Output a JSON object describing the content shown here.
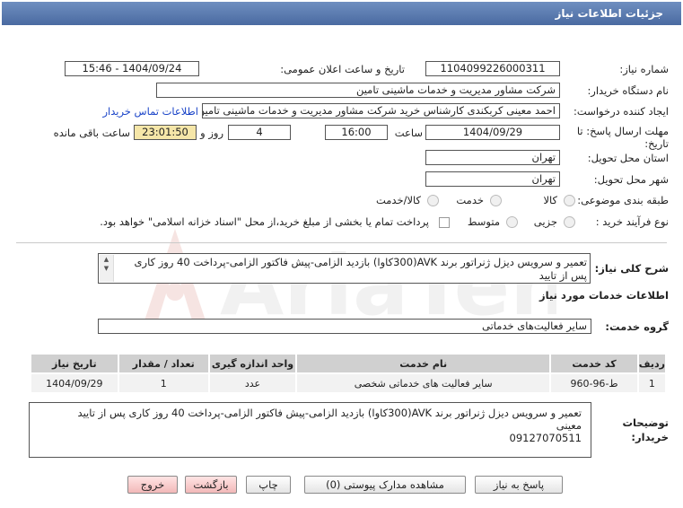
{
  "header": {
    "title": "جزئیات اطلاعات نیاز"
  },
  "form": {
    "need_number_label": "شماره نیاز:",
    "need_number": "1104099226000311",
    "announce_label": "تاریخ و ساعت اعلان عمومی:",
    "announce_value": "1404/09/24 - 15:46",
    "buyer_org_label": "نام دستگاه خریدار:",
    "buyer_org": "شرکت مشاور مدیریت و خدمات ماشینی تامین",
    "creator_label": "ایجاد کننده درخواست:",
    "creator": "احمد معینی کربکندی کارشناس خرید شرکت مشاور مدیریت و خدمات ماشینی تامین",
    "contact_link": "اطلاعات تماس خریدار",
    "deadline_label_1": "مهلت ارسال پاسخ: تا",
    "deadline_label_2": "تاریخ:",
    "deadline_date": "1404/09/29",
    "time_label": "ساعت",
    "deadline_time": "16:00",
    "days_value": "4",
    "days_label": "روز و",
    "remaining_time": "23:01:50",
    "remaining_label": "ساعت باقی مانده",
    "province_label": "استان محل تحویل:",
    "province": "تهران",
    "city_label": "شهر محل تحویل:",
    "city": "تهران",
    "category_label": "طبقه بندی موضوعی:",
    "category_options": [
      "کالا",
      "خدمت",
      "کالا/خدمت"
    ],
    "purchase_type_label": "نوع فرآیند خرید :",
    "purchase_type_options": [
      "جزیی",
      "متوسط"
    ],
    "payment_note": "پرداخت تمام یا بخشی از مبلغ خرید،از محل \"اسناد خزانه اسلامی\" خواهد بود."
  },
  "summary": {
    "label": "شرح کلی نیاز:",
    "text": "تعمیر و سرویس دیزل ژنراتور برند AVK(300کاوا)  بازدید الزامی-پیش فاکتور الزامی-پرداخت 40 روز کاری پس از تایید"
  },
  "services": {
    "section_title": "اطلاعات خدمات مورد نیاز",
    "group_label": "گروه خدمت:",
    "group_value": "سایر فعالیت‌های خدماتی",
    "columns": [
      "ردیف",
      "کد خدمت",
      "نام خدمت",
      "واحد اندازه گیری",
      "تعداد / مقدار",
      "تاریخ نیاز"
    ],
    "rows": [
      [
        "1",
        "ط-96-960",
        "سایر فعالیت های خدماتی شخصی",
        "عدد",
        "1",
        "1404/09/29"
      ]
    ]
  },
  "buyer_notes": {
    "label_1": "توضیحات",
    "label_2": "خریدار:",
    "line1": "تعمیر و سرویس دیزل ژنراتور برند AVK(300کاوا)  بازدید الزامی-پیش فاکتور الزامی-پرداخت 40 روز کاری پس از تایید",
    "line2": "معینی",
    "line3": "09127070511"
  },
  "buttons": {
    "reply": "پاسخ به نیاز",
    "view_docs": "مشاهده مدارک پیوستی (0)",
    "print": "چاپ",
    "back": "بازگشت",
    "exit": "خروج"
  },
  "watermark": {
    "text": "AriaTender.net"
  },
  "colors": {
    "header": "#5577b0",
    "highlight": "#f5e6a8",
    "link": "#1a44c8",
    "watermark": "#c0392b"
  }
}
